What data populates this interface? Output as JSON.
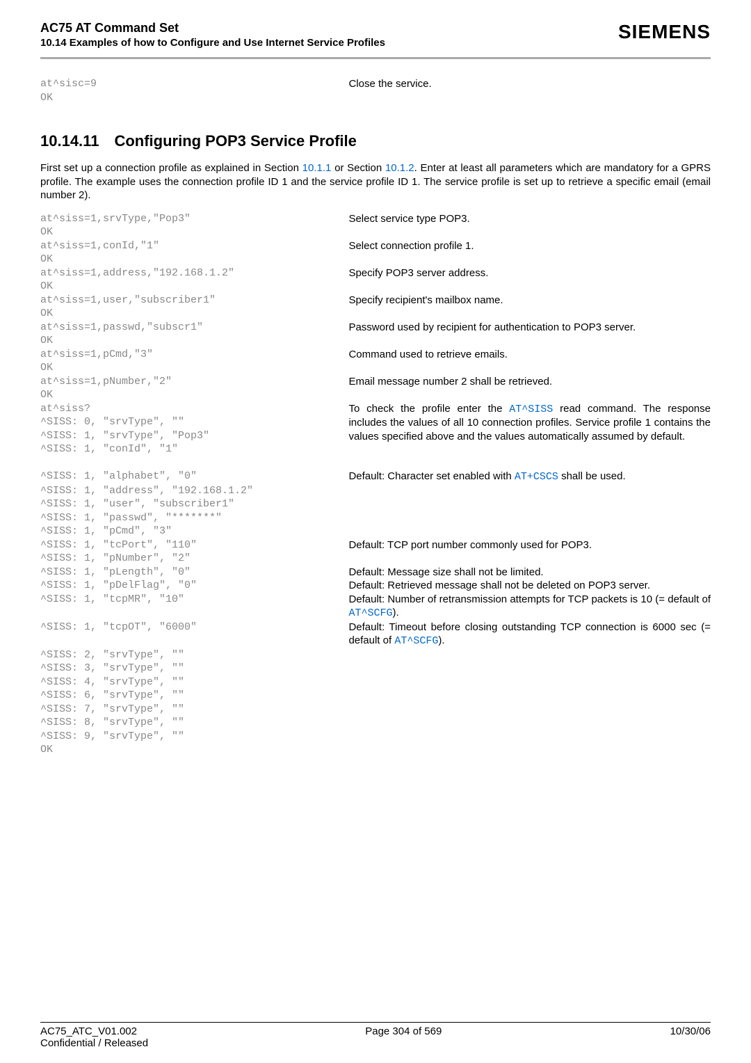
{
  "header": {
    "title": "AC75 AT Command Set",
    "subtitle": "10.14 Examples of how to Configure and Use Internet Service Profiles",
    "logo": "SIEMENS"
  },
  "top_block": {
    "l1": "at^sisc=9",
    "r1": "Close the service.",
    "l2": "OK"
  },
  "section": {
    "num": "10.14.11",
    "title": "Configuring POP3 Service Profile"
  },
  "intro": {
    "t1": "First set up a connection profile as explained in Section ",
    "link1": "10.1.1",
    "t2": " or Section ",
    "link2": "10.1.2",
    "t3": ". Enter at least all parameters which are mandatory for a GPRS profile. The example uses the connection profile ID 1 and the service profile ID 1. The service profile is set up to retrieve a specific email (email number 2)."
  },
  "rows": [
    {
      "l": "at^siss=1,srvType,\"Pop3\"",
      "r": "Select service type POP3."
    },
    {
      "l": "OK",
      "r": ""
    },
    {
      "l": "at^siss=1,conId,\"1\"",
      "r": "Select connection profile 1."
    },
    {
      "l": "OK",
      "r": ""
    },
    {
      "l": "at^siss=1,address,\"192.168.1.2\"",
      "r": "Specify POP3 server address."
    },
    {
      "l": "OK",
      "r": ""
    },
    {
      "l": "at^siss=1,user,\"subscriber1\"",
      "r": "Specify recipient's mailbox name."
    },
    {
      "l": "OK",
      "r": ""
    },
    {
      "l": "at^siss=1,passwd,\"subscr1\"",
      "r": "Password used by recipient for authentication to POP3 server."
    },
    {
      "l": "OK",
      "r": ""
    },
    {
      "l": "at^siss=1,pCmd,\"3\"",
      "r": "Command used to retrieve emails."
    },
    {
      "l": "OK",
      "r": ""
    },
    {
      "l": "at^siss=1,pNumber,\"2\"",
      "r": "Email message number 2 shall be retrieved."
    },
    {
      "l": "OK",
      "r": ""
    }
  ],
  "siss_query": {
    "l": "at^siss?",
    "r_pre": "To check the profile enter the ",
    "r_link": "AT^SISS",
    "r_post": " read command. The response includes the values of all 10 connection profiles. Service profile 1 contains the values specified above and the values automatically assumed by default.",
    "sub": [
      "^SISS: 0, \"srvType\", \"\"",
      "^SISS: 1, \"srvType\", \"Pop3\"",
      "^SISS: 1, \"conId\", \"1\""
    ]
  },
  "alphabet": {
    "l": "^SISS: 1, \"alphabet\", \"0\"",
    "r_pre": "Default: Character set enabled with ",
    "r_link": "AT+CSCS",
    "r_post": " shall be used."
  },
  "mid_rows": [
    {
      "l": "^SISS: 1, \"address\", \"192.168.1.2\"",
      "r": ""
    },
    {
      "l": "^SISS: 1, \"user\", \"subscriber1\"",
      "r": ""
    },
    {
      "l": "^SISS: 1, \"passwd\", \"*******\"",
      "r": ""
    },
    {
      "l": "^SISS: 1, \"pCmd\", \"3\"",
      "r": ""
    },
    {
      "l": "^SISS: 1, \"tcPort\", \"110\"",
      "r": "Default: TCP port number commonly used for POP3."
    },
    {
      "l": "^SISS: 1, \"pNumber\", \"2\"",
      "r": ""
    },
    {
      "l": "^SISS: 1, \"pLength\", \"0\"",
      "r": "Default: Message size shall not be limited."
    },
    {
      "l": "^SISS: 1, \"pDelFlag\", \"0\"",
      "r": "Default: Retrieved message shall not be deleted on POP3 server."
    }
  ],
  "tcpMR": {
    "l": "^SISS: 1, \"tcpMR\", \"10\"",
    "r_pre": "Default: Number of retransmission attempts for TCP packets is 10 (= default of ",
    "r_link": "AT^SCFG",
    "r_post": ")."
  },
  "tcpOT": {
    "l": "^SISS: 1, \"tcpOT\", \"6000\"",
    "r_pre": "Default: Timeout before closing outstanding TCP connection is 6000 sec (= default of ",
    "r_link": "AT^SCFG",
    "r_post": ")."
  },
  "tail_rows": [
    "^SISS: 2, \"srvType\", \"\"",
    "^SISS: 3, \"srvType\", \"\"",
    "^SISS: 4, \"srvType\", \"\"",
    "^SISS: 6, \"srvType\", \"\"",
    "^SISS: 7, \"srvType\", \"\"",
    "^SISS: 8, \"srvType\", \"\"",
    "^SISS: 9, \"srvType\", \"\"",
    "OK"
  ],
  "footer": {
    "left1": "AC75_ATC_V01.002",
    "center": "Page 304 of 569",
    "right": "10/30/06",
    "left2": "Confidential / Released"
  }
}
